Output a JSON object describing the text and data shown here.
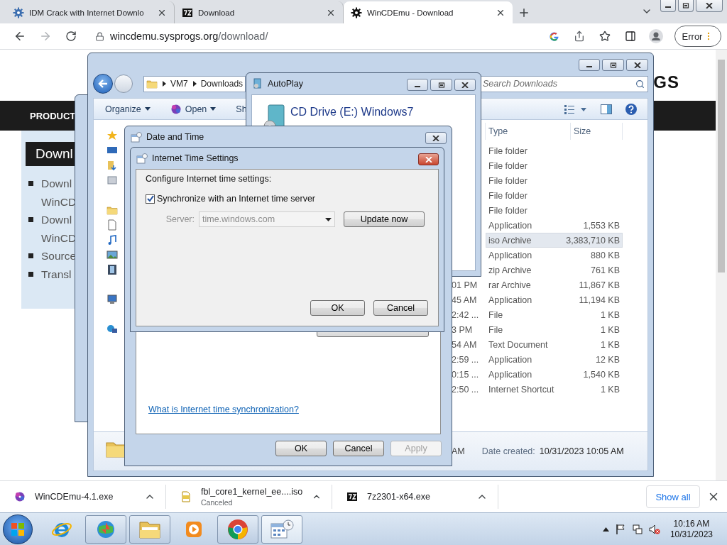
{
  "browser": {
    "tabs": [
      {
        "title": "IDM Crack with Internet Downlo",
        "selected": false
      },
      {
        "title": "Download",
        "selected": false
      },
      {
        "title": "WinCDEmu - Download",
        "selected": true
      }
    ],
    "url": {
      "host": "wincdemu.sysprogs.org",
      "path": "/download/"
    },
    "profile_button": "Error"
  },
  "webpage": {
    "logo": "GS",
    "nav_item": "PRODUCT",
    "heading": "Downl",
    "list": [
      {
        "lines": [
          "Downl",
          "WinCD"
        ]
      },
      {
        "lines": [
          "Downl",
          "WinCD"
        ]
      },
      {
        "lines": [
          "Source"
        ]
      },
      {
        "lines": [
          "Transl"
        ]
      }
    ]
  },
  "explorer": {
    "breadcrumb": [
      "VM7",
      "Downloads"
    ],
    "search_placeholder": "Search Downloads",
    "toolbar": [
      "Organize",
      "Open",
      "Sh"
    ],
    "columns": [
      "Type",
      "Size"
    ],
    "files": [
      {
        "type": "File folder",
        "selected": false
      },
      {
        "type": "File folder",
        "selected": false
      },
      {
        "type": "File folder",
        "selected": false
      },
      {
        "type": "File folder",
        "selected": false
      },
      {
        "type": "File folder",
        "selected": false
      },
      {
        "type": "Application",
        "size": "1,553 KB",
        "selected": false
      },
      {
        "type": "iso Archive",
        "size": "3,383,710 KB",
        "selected": true
      },
      {
        "type": "Application",
        "size": "880 KB",
        "selected": false
      },
      {
        "type": "zip Archive",
        "size": "761 KB",
        "selected": false
      },
      {
        "date": "01 PM",
        "type": "rar Archive",
        "size": "11,867 KB",
        "selected": false
      },
      {
        "date": "45 AM",
        "type": "Application",
        "size": "11,194 KB",
        "selected": false
      },
      {
        "date": "2:42 ...",
        "type": "File",
        "size": "1 KB",
        "selected": false
      },
      {
        "date": "3 PM",
        "type": "File",
        "size": "1 KB",
        "selected": false
      },
      {
        "date": "54 AM",
        "type": "Text Document",
        "size": "1 KB",
        "selected": false
      },
      {
        "date": "2:59 ...",
        "type": "Application",
        "size": "12 KB",
        "selected": false
      },
      {
        "date": "0:15 ...",
        "type": "Application",
        "size": "1,540 KB",
        "selected": false
      },
      {
        "date": "2:50 ...",
        "type": "Internet Shortcut",
        "size": "1 KB",
        "selected": false
      }
    ],
    "details": {
      "time_fragment": "AM",
      "label": "Date created:",
      "value": "10/31/2023 10:05 AM"
    }
  },
  "autoplay": {
    "title": "AutoPlay",
    "drive": "CD Drive (E:) Windows7"
  },
  "date_time": {
    "title": "Date and Time",
    "help_link": "What is Internet time synchronization?",
    "buttons": [
      {
        "label": "OK",
        "disabled": false
      },
      {
        "label": "Cancel",
        "disabled": false
      },
      {
        "label": "Apply",
        "disabled": true
      }
    ]
  },
  "internet_time": {
    "title": "Internet Time Settings",
    "heading": "Configure Internet time settings:",
    "sync": {
      "label": "Synchronize with an Internet time server",
      "checked": true
    },
    "server_label": "Server:",
    "server": "time.windows.com",
    "server_disabled": true,
    "update_button": "Update now",
    "buttons": [
      "OK",
      "Cancel"
    ]
  },
  "downloads": [
    {
      "name": "WinCDEmu-4.1.exe"
    },
    {
      "name": "fbl_core1_kernel_ee....iso",
      "status": "Canceled"
    },
    {
      "name": "7z2301-x64.exe"
    }
  ],
  "show_all": "Show all",
  "taskbar": {
    "apps": [
      {
        "kind": "ie",
        "running": false,
        "selected": false
      },
      {
        "kind": "idm",
        "running": true,
        "selected": false
      },
      {
        "kind": "explorer",
        "running": true,
        "selected": false
      },
      {
        "kind": "media",
        "running": false,
        "selected": false
      },
      {
        "kind": "chrome",
        "running": true,
        "selected": false
      },
      {
        "kind": "datetime",
        "running": true,
        "selected": true
      }
    ],
    "time": "10:16 AM",
    "date": "10/31/2023"
  }
}
